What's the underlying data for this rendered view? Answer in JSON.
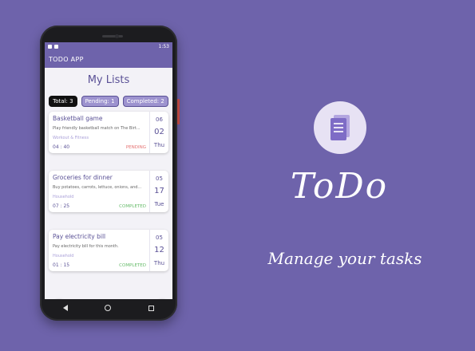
{
  "status_bar": {
    "time": "1:53"
  },
  "app": {
    "title": "TODO APP",
    "page_title": "My Lists"
  },
  "filters": [
    {
      "label": "Total: 3",
      "active": true
    },
    {
      "label": "Pending: 1",
      "active": false
    },
    {
      "label": "Completed: 2",
      "active": false
    }
  ],
  "tasks": [
    {
      "title": "Basketball game",
      "description": "Play friendly basketball match on The Birt...",
      "category": "Workout & Fitness",
      "time": "04 : 40",
      "status": "PENDING",
      "month": "06",
      "day": "02",
      "weekday": "Thu"
    },
    {
      "title": "Groceries for dinner",
      "description": "Buy potatoes, carrots, lettuce, onions, and...",
      "category": "Household",
      "time": "07 : 25",
      "status": "COMPLETED",
      "month": "05",
      "day": "17",
      "weekday": "Tue"
    },
    {
      "title": "Pay electricity bill",
      "description": "Pay electricity bill for this month.",
      "category": "Household",
      "time": "01 : 15",
      "status": "COMPLETED",
      "month": "05",
      "day": "12",
      "weekday": "Thu"
    }
  ],
  "fab": {
    "menu_icon": "≡",
    "add_icon": "+"
  },
  "promo": {
    "title": "ToDo",
    "tagline": "Manage your tasks"
  },
  "colors": {
    "primary": "#6e63ab",
    "pending": "#e57373",
    "completed": "#66bb6a"
  }
}
